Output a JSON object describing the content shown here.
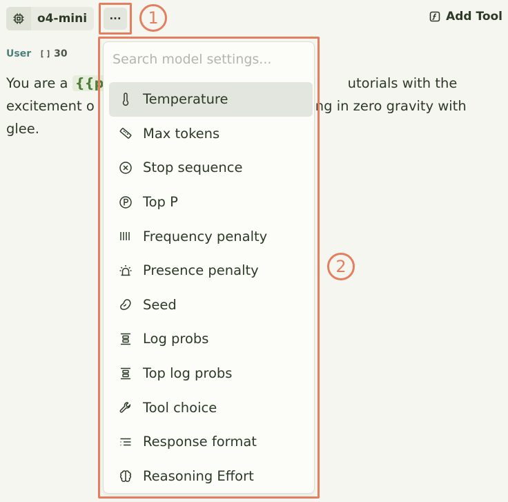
{
  "toolbar": {
    "model_name": "o4-mini",
    "more_label": "···",
    "add_tool_label": "Add Tool",
    "callout_1": "1",
    "callout_2": "2"
  },
  "message": {
    "role": "User",
    "token_count": "30",
    "text_before": "You are a ",
    "variable": "{{pe",
    "text_after_1": "utorials with the",
    "line_2_start": "excitement o",
    "line_2_end": "ng in zero gravity with",
    "line_3": "glee."
  },
  "dropdown": {
    "search_placeholder": "Search model settings...",
    "items": [
      {
        "label": "Temperature",
        "icon": "thermometer-icon"
      },
      {
        "label": "Max tokens",
        "icon": "ruler-icon"
      },
      {
        "label": "Stop sequence",
        "icon": "x-circle-icon"
      },
      {
        "label": "Top P",
        "icon": "p-circle-icon"
      },
      {
        "label": "Frequency penalty",
        "icon": "bars-icon"
      },
      {
        "label": "Presence penalty",
        "icon": "siren-icon"
      },
      {
        "label": "Seed",
        "icon": "bean-icon"
      },
      {
        "label": "Log probs",
        "icon": "align-center-icon"
      },
      {
        "label": "Top log probs",
        "icon": "align-center-icon"
      },
      {
        "label": "Tool choice",
        "icon": "wrench-icon"
      },
      {
        "label": "Response format",
        "icon": "list-indent-icon"
      },
      {
        "label": "Reasoning Effort",
        "icon": "brain-icon"
      }
    ]
  },
  "colors": {
    "annotation": "#e57d5f",
    "text": "#2d3a27",
    "role": "#4a7f7a",
    "variable": "#4f7d3c",
    "active_item_bg": "#e3e6de"
  }
}
